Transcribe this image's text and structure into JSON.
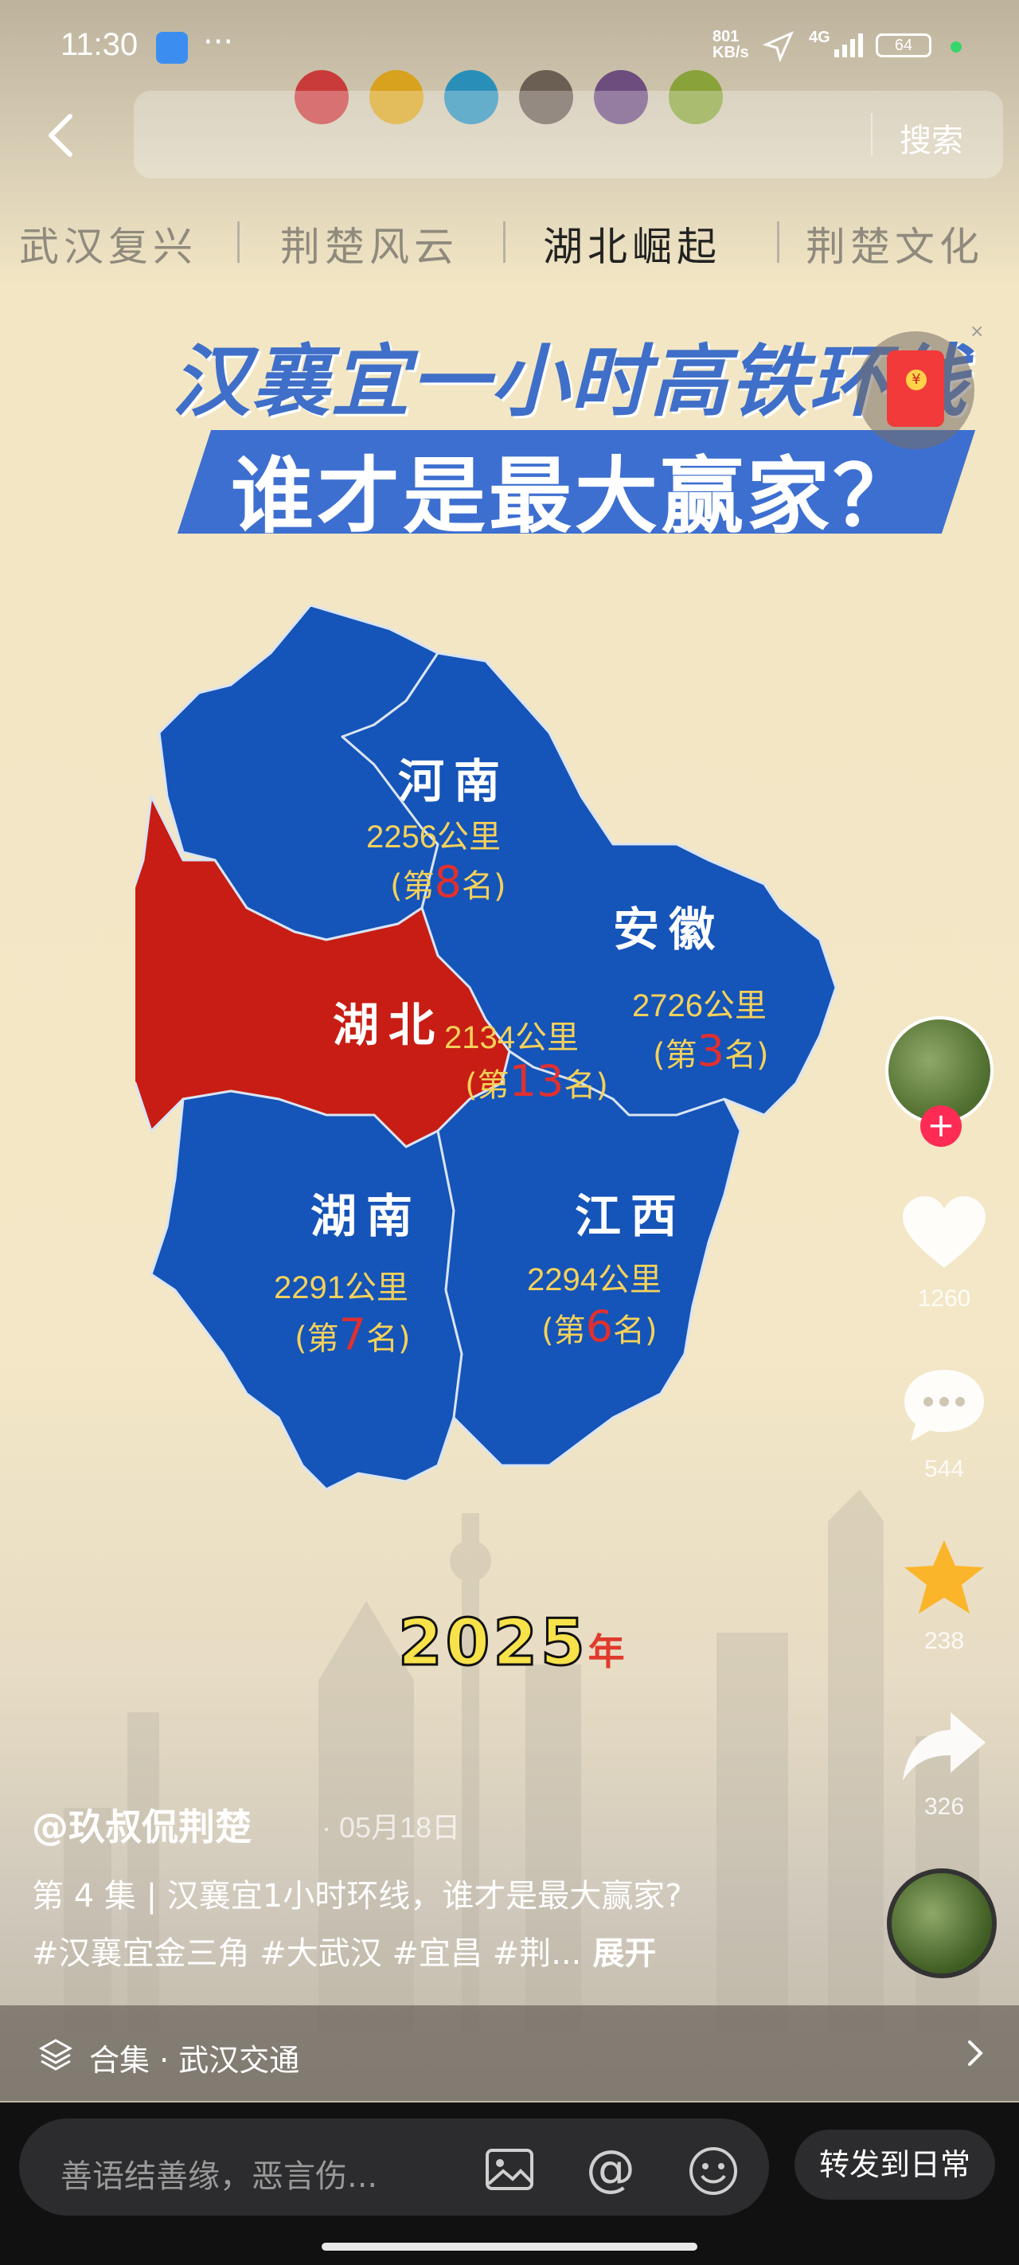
{
  "status_bar": {
    "time": "11:30",
    "more": "···",
    "net_speed_value": "801",
    "net_speed_unit": "KB/s",
    "network": "4G",
    "battery": "64"
  },
  "top_bar": {
    "search_placeholder": "",
    "search_button": "搜索"
  },
  "tabs": [
    "武汉复兴",
    "荆楚风云",
    "湖北崛起",
    "荆楚文化"
  ],
  "active_tab": "湖北崛起",
  "video": {
    "title_line1": "汉襄宜一小时高铁环线",
    "title_line2": "谁才是最大赢家？",
    "provinces": {
      "henan": {
        "name": "河南",
        "distance": "2256公里",
        "rank_prefix": "(第",
        "rank": "8",
        "rank_suffix": "名)"
      },
      "anhui": {
        "name": "安徽",
        "distance": "2726公里",
        "rank_prefix": "(第",
        "rank": "3",
        "rank_suffix": "名)"
      },
      "hubei": {
        "name": "湖北",
        "distance": "2134公里",
        "rank_prefix": "(第",
        "rank": "13",
        "rank_suffix": "名)"
      },
      "hunan": {
        "name": "湖南",
        "distance": "2291公里",
        "rank_prefix": "(第",
        "rank": "7",
        "rank_suffix": "名)"
      },
      "jiangxi": {
        "name": "江西",
        "distance": "2294公里",
        "rank_prefix": "(第",
        "rank": "6",
        "rank_suffix": "名)"
      }
    },
    "year": "2025",
    "year_suffix": "年",
    "colors": {
      "province_blue": "#1554b8",
      "hubei_red": "#c81d14"
    }
  },
  "actions": {
    "likes": "1260",
    "comments": "544",
    "favorites": "238",
    "shares": "326"
  },
  "caption": {
    "author": "@玖叔侃荆楚",
    "date": "· 05月18日",
    "line1": "第 4 集 | 汉襄宜1小时环线，谁才是最大赢家?",
    "line2": "#汉襄宜金三角 #大武汉 #宜昌 #荆...",
    "expand": "展开"
  },
  "collection": {
    "label": "合集 · 武汉交通"
  },
  "bottom_bar": {
    "comment_placeholder": "善语结善缘，恶言伤...",
    "share_button": "转发到日常"
  }
}
